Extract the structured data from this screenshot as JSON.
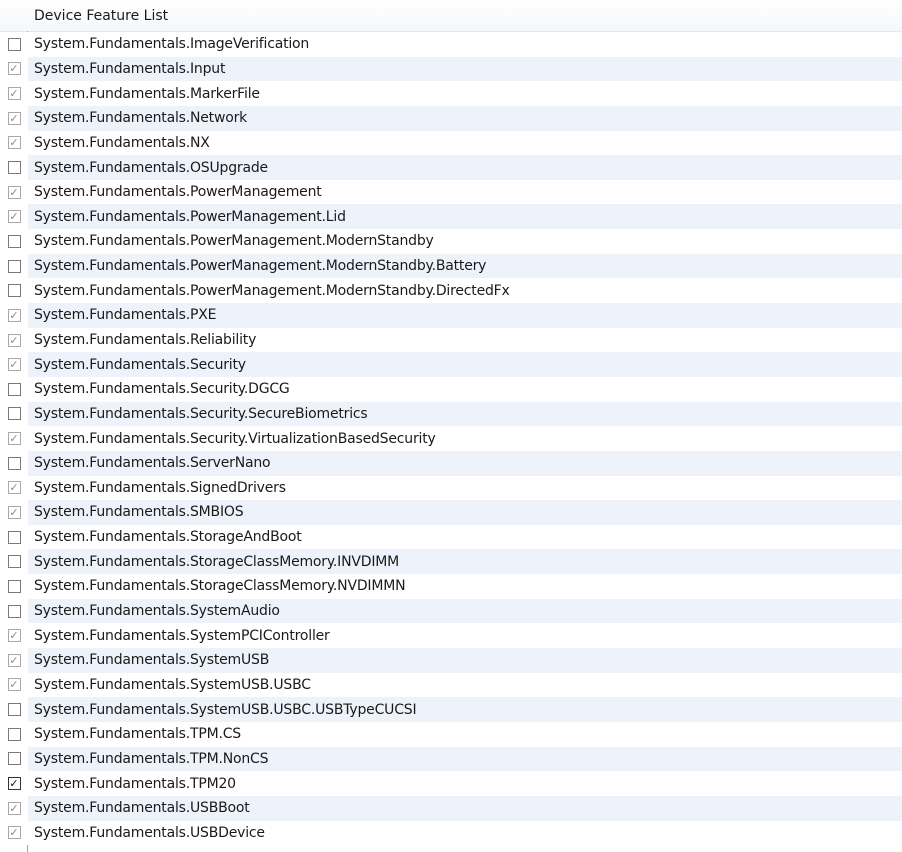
{
  "header": {
    "title": "Device Feature List"
  },
  "features": [
    {
      "label": "System.Fundamentals.ImageVerification",
      "state": "unchecked"
    },
    {
      "label": "System.Fundamentals.Input",
      "state": "checked"
    },
    {
      "label": "System.Fundamentals.MarkerFile",
      "state": "checked"
    },
    {
      "label": "System.Fundamentals.Network",
      "state": "checked"
    },
    {
      "label": "System.Fundamentals.NX",
      "state": "checked"
    },
    {
      "label": "System.Fundamentals.OSUpgrade",
      "state": "unchecked"
    },
    {
      "label": "System.Fundamentals.PowerManagement",
      "state": "checked"
    },
    {
      "label": "System.Fundamentals.PowerManagement.Lid",
      "state": "checked"
    },
    {
      "label": "System.Fundamentals.PowerManagement.ModernStandby",
      "state": "unchecked"
    },
    {
      "label": "System.Fundamentals.PowerManagement.ModernStandby.Battery",
      "state": "unchecked"
    },
    {
      "label": "System.Fundamentals.PowerManagement.ModernStandby.DirectedFx",
      "state": "unchecked"
    },
    {
      "label": "System.Fundamentals.PXE",
      "state": "checked"
    },
    {
      "label": "System.Fundamentals.Reliability",
      "state": "checked"
    },
    {
      "label": "System.Fundamentals.Security",
      "state": "checked"
    },
    {
      "label": "System.Fundamentals.Security.DGCG",
      "state": "unchecked"
    },
    {
      "label": "System.Fundamentals.Security.SecureBiometrics",
      "state": "unchecked"
    },
    {
      "label": "System.Fundamentals.Security.VirtualizationBasedSecurity",
      "state": "checked"
    },
    {
      "label": "System.Fundamentals.ServerNano",
      "state": "unchecked"
    },
    {
      "label": "System.Fundamentals.SignedDrivers",
      "state": "checked"
    },
    {
      "label": "System.Fundamentals.SMBIOS",
      "state": "checked"
    },
    {
      "label": "System.Fundamentals.StorageAndBoot",
      "state": "unchecked"
    },
    {
      "label": "System.Fundamentals.StorageClassMemory.INVDIMM",
      "state": "unchecked"
    },
    {
      "label": "System.Fundamentals.StorageClassMemory.NVDIMMN",
      "state": "unchecked"
    },
    {
      "label": "System.Fundamentals.SystemAudio",
      "state": "unchecked"
    },
    {
      "label": "System.Fundamentals.SystemPCIController",
      "state": "checked"
    },
    {
      "label": "System.Fundamentals.SystemUSB",
      "state": "checked"
    },
    {
      "label": "System.Fundamentals.SystemUSB.USBC",
      "state": "checked"
    },
    {
      "label": "System.Fundamentals.SystemUSB.USBC.USBTypeCUCSI",
      "state": "unchecked"
    },
    {
      "label": "System.Fundamentals.TPM.CS",
      "state": "unchecked"
    },
    {
      "label": "System.Fundamentals.TPM.NonCS",
      "state": "unchecked"
    },
    {
      "label": "System.Fundamentals.TPM20",
      "state": "checked-strong"
    },
    {
      "label": "System.Fundamentals.USBBoot",
      "state": "checked"
    },
    {
      "label": "System.Fundamentals.USBDevice",
      "state": "checked"
    }
  ],
  "icons": {
    "check": "✓",
    "checkbox": "checkbox-icon",
    "checkmark": "checkmark-icon"
  },
  "colors": {
    "alt_row": "#eef3fb",
    "divider": "#a0a0a0",
    "disabled_check": "#8a8a8a",
    "active_check": "#111111"
  }
}
